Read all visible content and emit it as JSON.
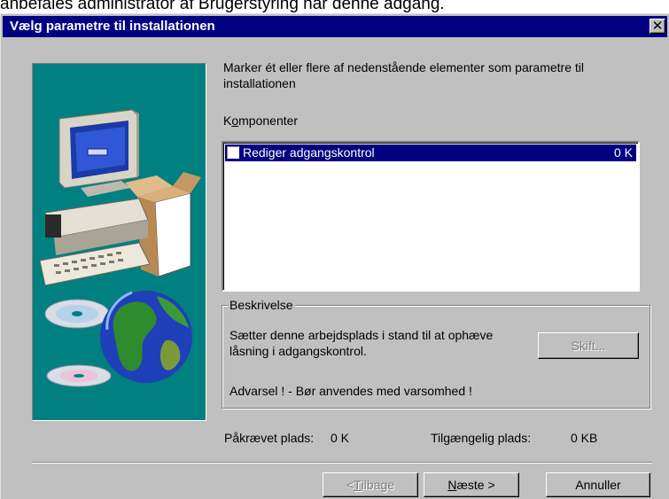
{
  "background_text": "anbefales administrator af Brugerstyring når denne adgang.",
  "window": {
    "title": "Vælg parametre til installationen",
    "close_symbol": "✕"
  },
  "intro_text": "Marker ét eller flere af nedenstående elementer som parametre til installationen",
  "components": {
    "label_prefix": "K",
    "label_underlined": "o",
    "label_rest": "mponenter",
    "items": [
      {
        "label": "Rediger adgangskontrol",
        "size": "0 K",
        "checked": false,
        "selected": true
      }
    ]
  },
  "description": {
    "legend": "Beskrivelse",
    "text": "Sætter denne arbejdsplads i stand til at ophæve låsning i adgangskontrol.",
    "warning": "Advarsel ! - Bør anvendes med varsomhed !",
    "change_button": "Skift..."
  },
  "space": {
    "required_label": "Påkrævet plads:",
    "required_value": "0 K",
    "available_label": "Tilgængelig plads:",
    "available_value": "0 KB"
  },
  "buttons": {
    "back_prefix": "< ",
    "back_underlined": "T",
    "back_rest": "ilbage",
    "next_underlined": "N",
    "next_rest": "æste >",
    "cancel": "Annuller"
  },
  "colors": {
    "titlebar": "#000080",
    "dialog": "#c0c0c0",
    "art_background": "#008080",
    "selection": "#000080"
  },
  "icons": [
    "computer-setup-illustration",
    "cd-discs-icon",
    "globe-icon",
    "close-icon"
  ]
}
